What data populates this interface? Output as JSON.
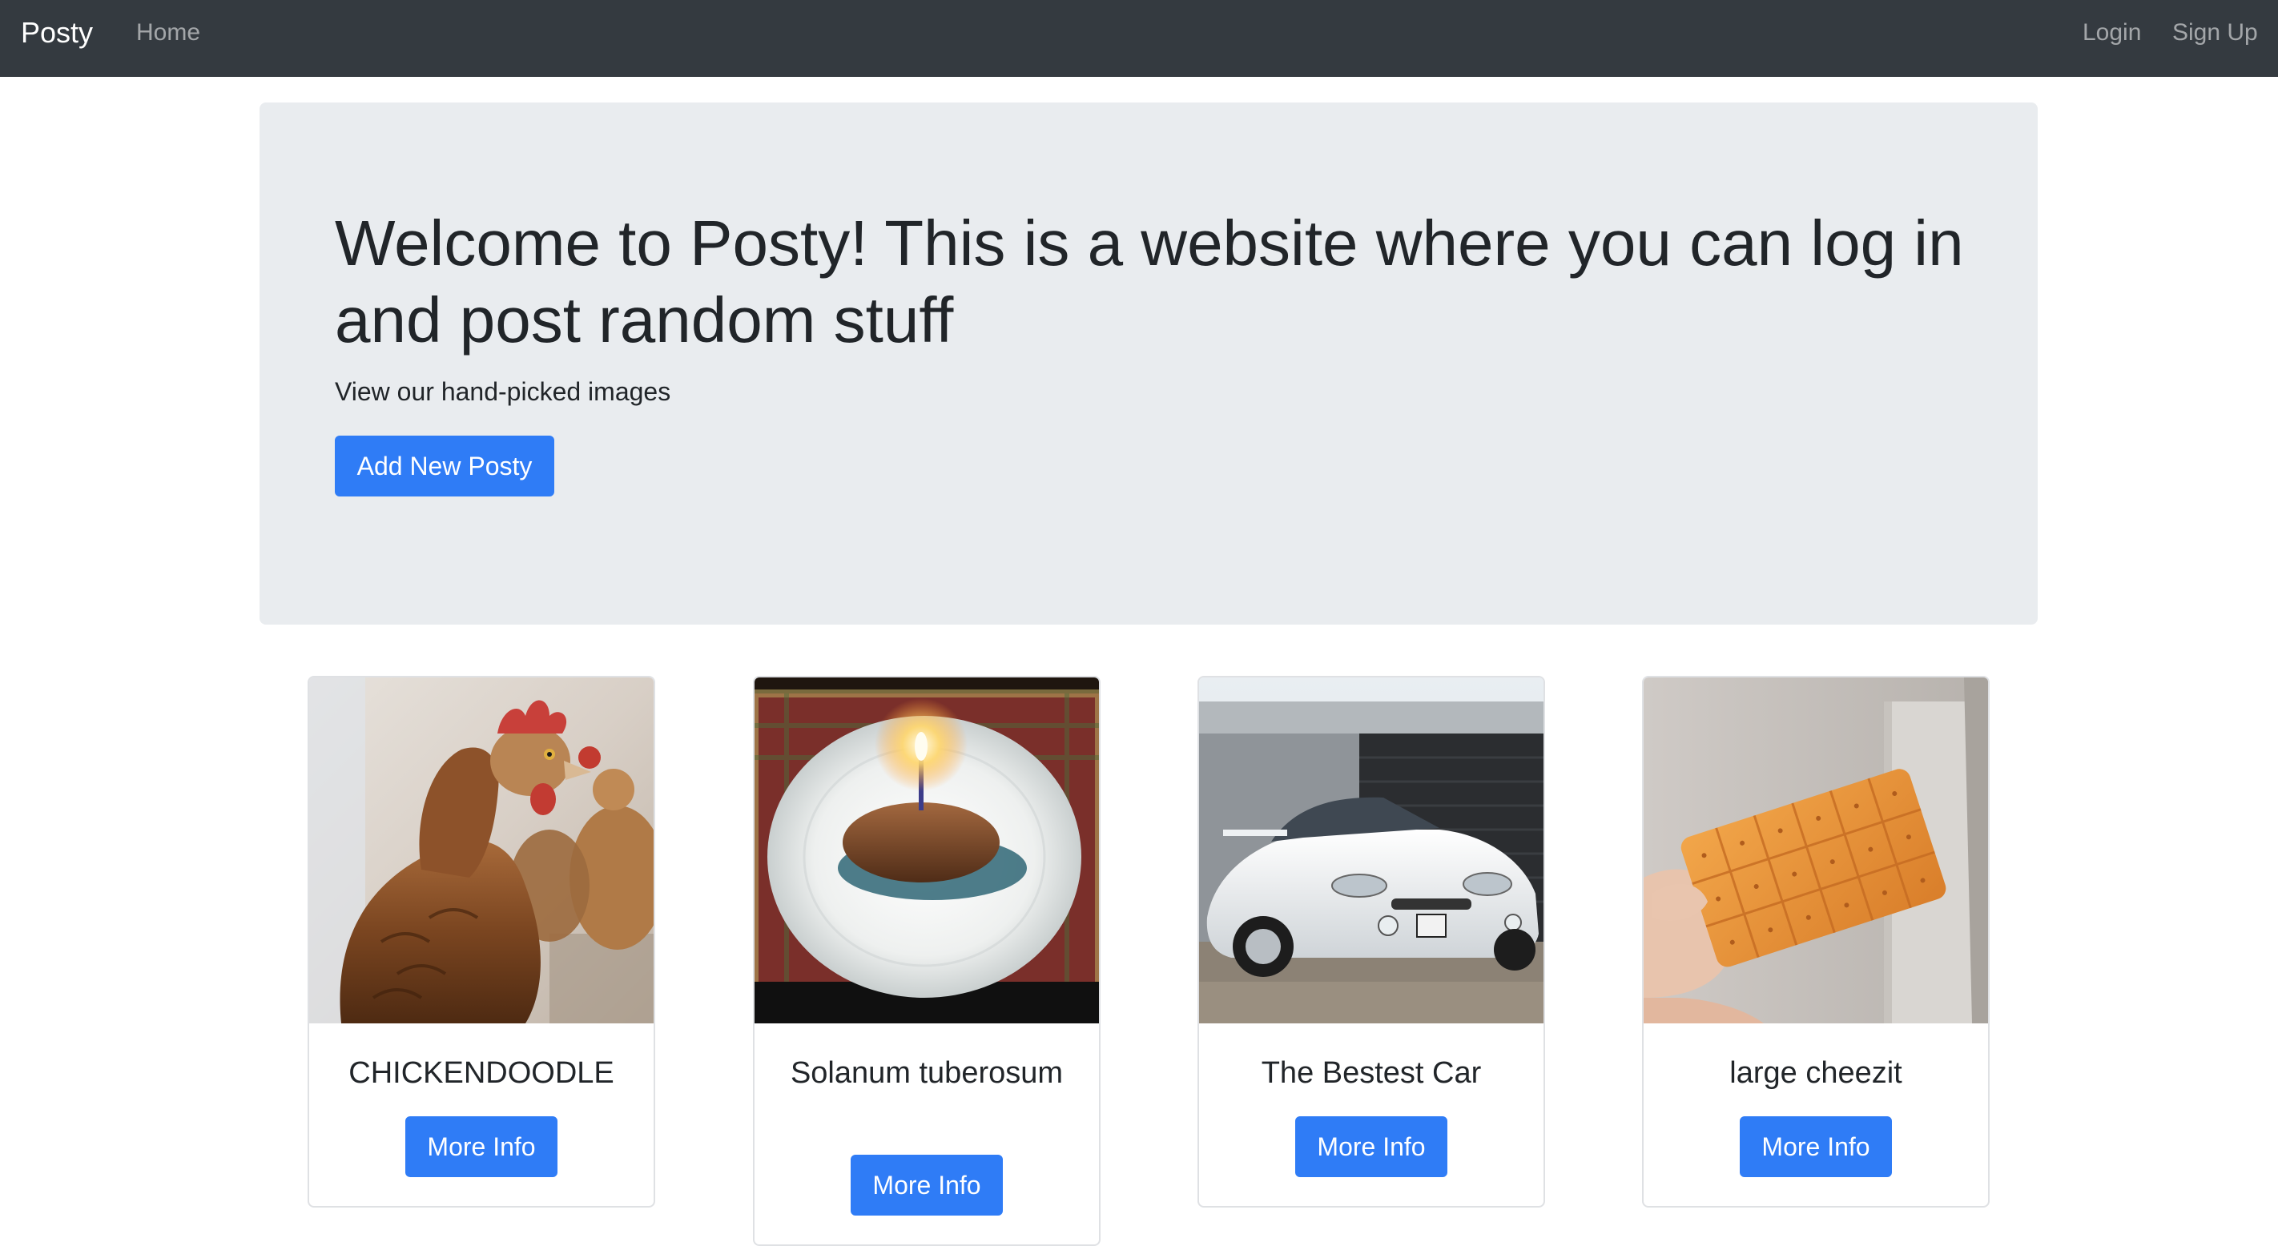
{
  "navbar": {
    "brand": "Posty",
    "links": {
      "home": "Home",
      "login": "Login",
      "signup": "Sign Up"
    }
  },
  "jumbotron": {
    "title": "Welcome to Posty! This is a website where you can log in and post random stuff",
    "lead": "View our hand-picked images",
    "button_label": "Add New Posty"
  },
  "posts": [
    {
      "title": "CHICKENDOODLE",
      "button_label": "More Info",
      "image": "chicken-photo"
    },
    {
      "title": "Solanum tuberosum",
      "button_label": "More Info",
      "image": "potato-with-candle-photo"
    },
    {
      "title": "The Bestest Car",
      "button_label": "More Info",
      "image": "white-car-photo"
    },
    {
      "title": "large cheezit",
      "button_label": "More Info",
      "image": "cracker-in-hand-photo"
    }
  ],
  "colors": {
    "navbar": "#343a40",
    "jumbotron": "#e9ecef",
    "primary": "#2f7cf6"
  }
}
